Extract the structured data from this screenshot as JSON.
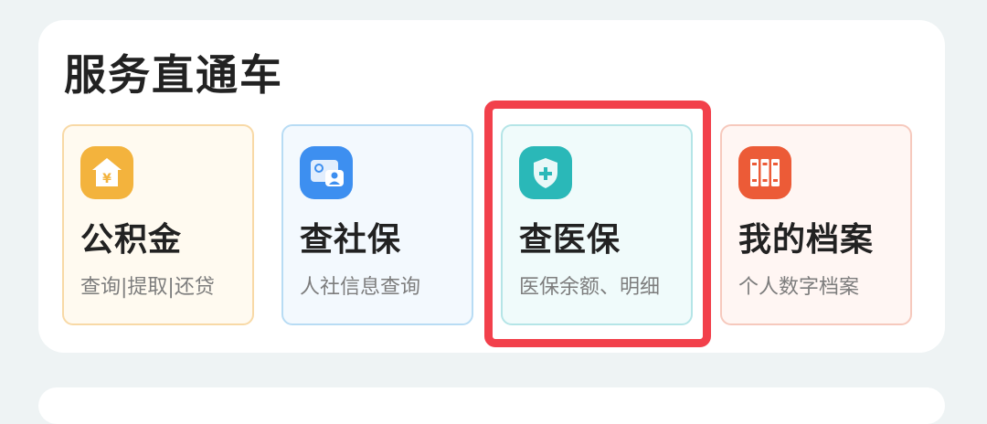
{
  "section": {
    "title": "服务直通车"
  },
  "cards": [
    {
      "title": "公积金",
      "subtitle": "查询|提取|还贷",
      "icon": "housing-fund-icon",
      "icon_color": "#f3b33d",
      "bg_color": "#fffaf0",
      "border_color": "#f8d9a6"
    },
    {
      "title": "查社保",
      "subtitle": "人社信息查询",
      "icon": "social-security-card-icon",
      "icon_color": "#3d8ff0",
      "bg_color": "#f3f9fe",
      "border_color": "#b8dcf4"
    },
    {
      "title": "查医保",
      "subtitle": "医保余额、明细",
      "icon": "medical-shield-icon",
      "icon_color": "#2ab8b8",
      "bg_color": "#f0fbfb",
      "border_color": "#b5e5e7"
    },
    {
      "title": "我的档案",
      "subtitle": "个人数字档案",
      "icon": "archive-folders-icon",
      "icon_color": "#ec5b37",
      "bg_color": "#fff6f3",
      "border_color": "#f6c9bd"
    }
  ],
  "highlight": {
    "color": "#f2404b",
    "target": "查医保"
  }
}
